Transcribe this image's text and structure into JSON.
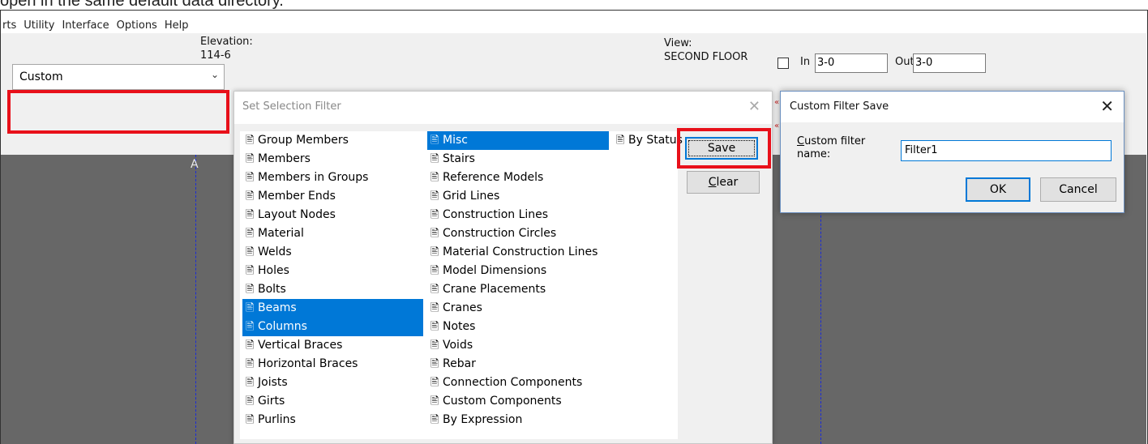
{
  "caption": "open in the same default data directory.",
  "menubar": {
    "items": [
      "rts",
      "Utility",
      "Interface",
      "Options",
      "Help"
    ]
  },
  "toolbar": {
    "elevation_label": "Elevation:",
    "elevation_value": "114-6",
    "view_label": "View:",
    "view_value": "SECOND FLOOR",
    "in_label": "In",
    "in_value": "3-0",
    "out_label": "Out",
    "out_value": "3-0",
    "filter_combo_value": "Custom"
  },
  "canvas": {
    "axis_label": "A"
  },
  "selection_filter_dialog": {
    "title": "Set Selection Filter",
    "column1": [
      {
        "label": "Group Members",
        "selected": false
      },
      {
        "label": "Members",
        "selected": false
      },
      {
        "label": "Members in Groups",
        "selected": false
      },
      {
        "label": "Member Ends",
        "selected": false
      },
      {
        "label": "Layout Nodes",
        "selected": false
      },
      {
        "label": "Material",
        "selected": false
      },
      {
        "label": "Welds",
        "selected": false
      },
      {
        "label": "Holes",
        "selected": false
      },
      {
        "label": "Bolts",
        "selected": false
      },
      {
        "label": "Beams",
        "selected": true
      },
      {
        "label": "Columns",
        "selected": true
      },
      {
        "label": "Vertical Braces",
        "selected": false
      },
      {
        "label": "Horizontal Braces",
        "selected": false
      },
      {
        "label": "Joists",
        "selected": false
      },
      {
        "label": "Girts",
        "selected": false
      },
      {
        "label": "Purlins",
        "selected": false
      }
    ],
    "column2": [
      {
        "label": "Misc",
        "selected": true
      },
      {
        "label": "Stairs",
        "selected": false
      },
      {
        "label": "Reference Models",
        "selected": false
      },
      {
        "label": "Grid Lines",
        "selected": false
      },
      {
        "label": "Construction Lines",
        "selected": false
      },
      {
        "label": "Construction Circles",
        "selected": false
      },
      {
        "label": "Material Construction Lines",
        "selected": false
      },
      {
        "label": "Model Dimensions",
        "selected": false
      },
      {
        "label": "Crane Placements",
        "selected": false
      },
      {
        "label": "Cranes",
        "selected": false
      },
      {
        "label": "Notes",
        "selected": false
      },
      {
        "label": "Voids",
        "selected": false
      },
      {
        "label": "Rebar",
        "selected": false
      },
      {
        "label": "Connection Components",
        "selected": false
      },
      {
        "label": "Custom Components",
        "selected": false
      },
      {
        "label": "By Expression",
        "selected": false
      }
    ],
    "column3": [
      {
        "label": "By Status",
        "selected": false
      }
    ],
    "save_button": "Save",
    "clear_button_prefix": "C",
    "clear_button_rest": "lear"
  },
  "custom_filter_save_dialog": {
    "title": "Custom Filter Save",
    "label_first_letter": "C",
    "label_rest_line1": "ustom filter",
    "label_line2": "name:",
    "input_value": "Filter1",
    "ok_button": "OK",
    "cancel_button": "Cancel"
  },
  "colors": {
    "highlight_box": "#e8101a",
    "selection": "#0078d7",
    "canvas": "#676767",
    "grid_line": "#1a2bd8"
  }
}
